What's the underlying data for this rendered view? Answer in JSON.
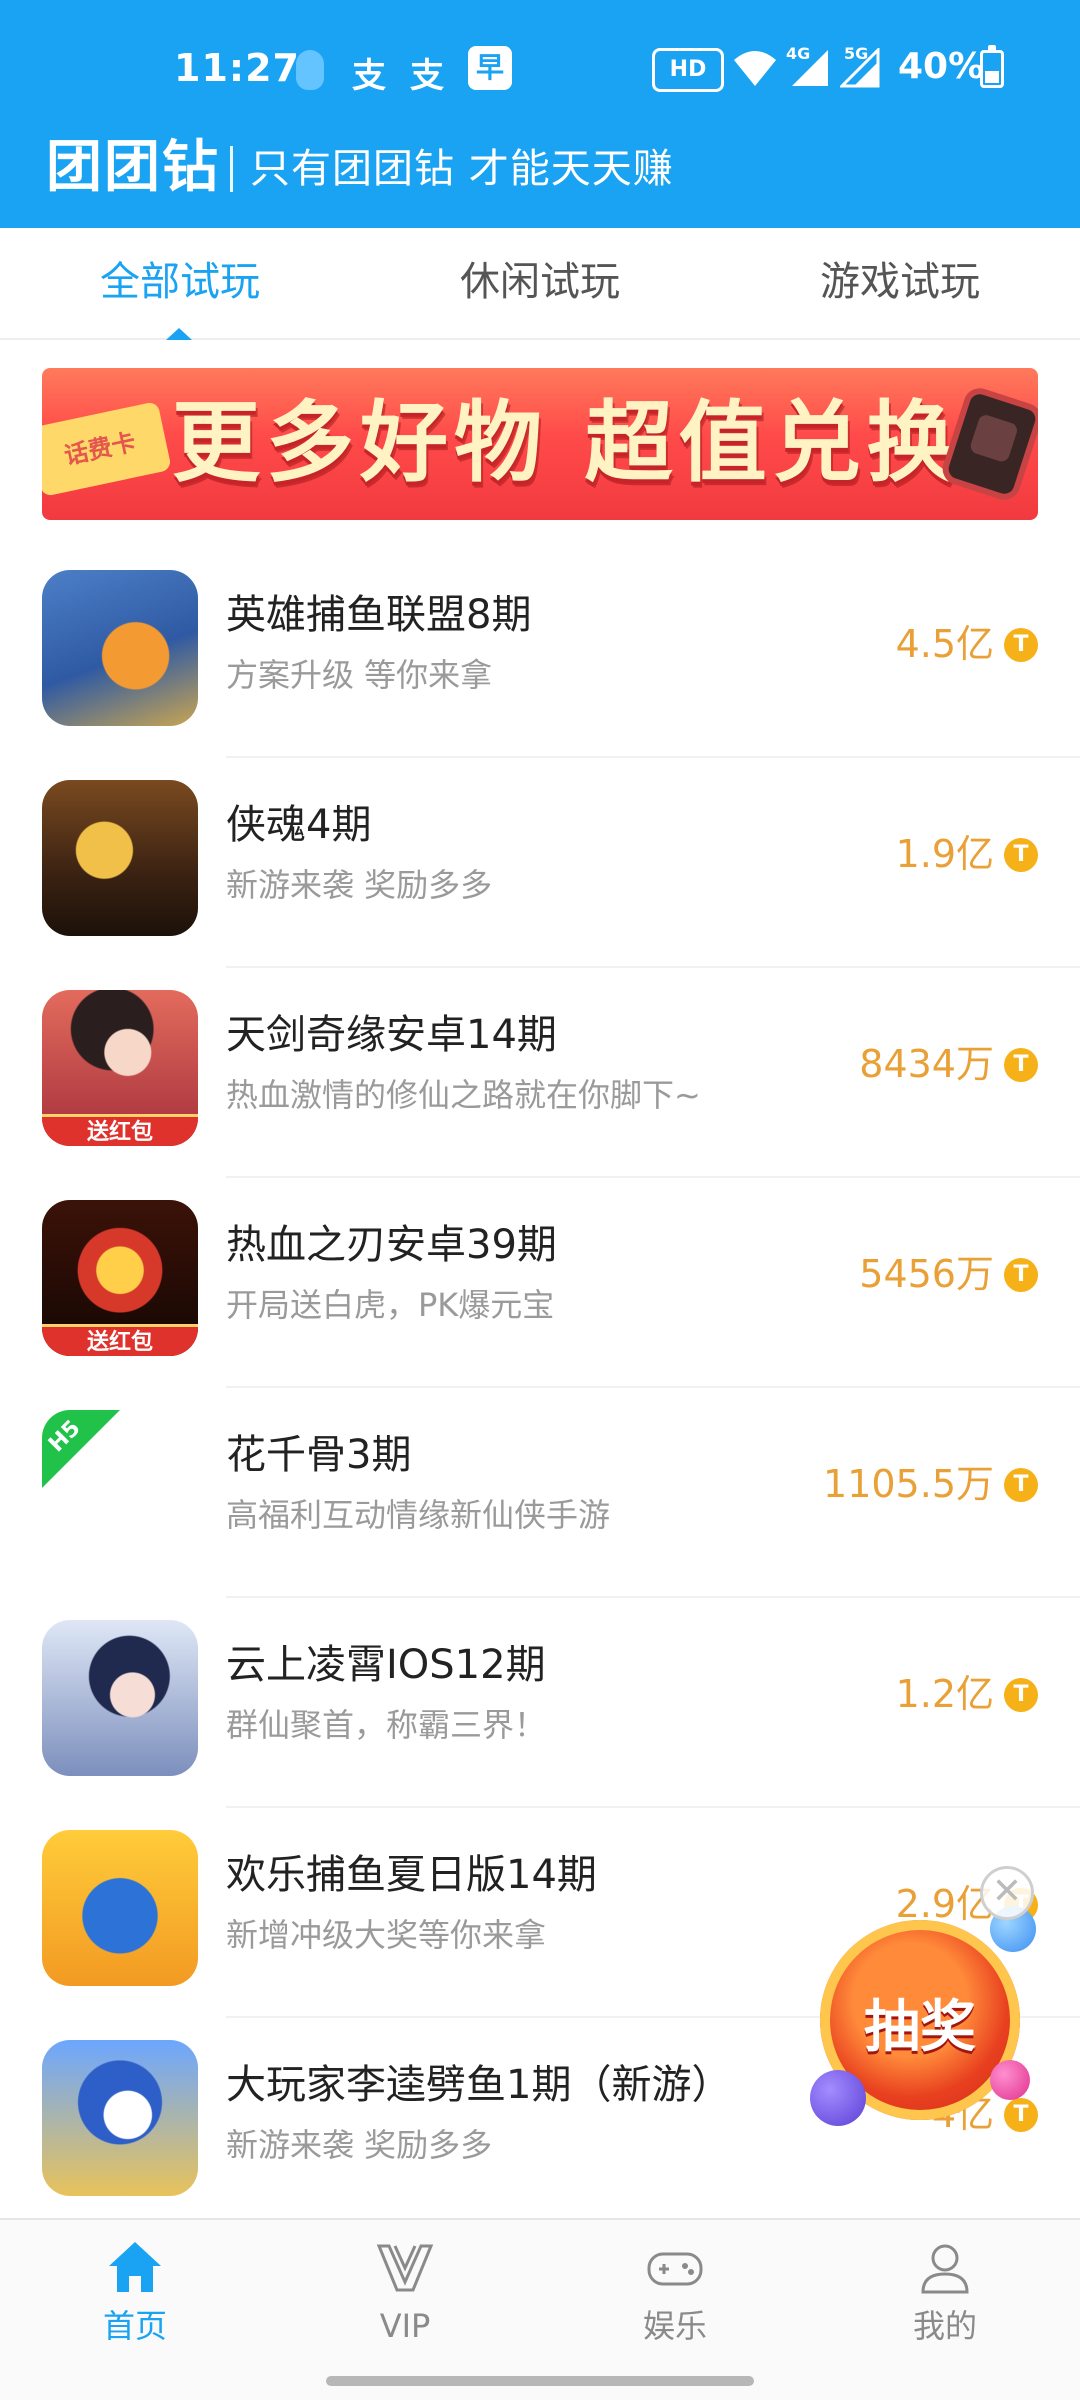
{
  "status_bar": {
    "time": "11:27",
    "app_glyphs": [
      "支",
      "支",
      "早"
    ],
    "hd_label": "HD",
    "net_labels": [
      "4G",
      "5G"
    ],
    "battery_percent": "40%"
  },
  "header": {
    "brand": "团团钻",
    "slogan": "只有团团钻 才能天天赚",
    "background_color": "#1aa3f2"
  },
  "tabs": [
    {
      "label": "全部试玩",
      "active": true
    },
    {
      "label": "休闲试玩",
      "active": false
    },
    {
      "label": "游戏试玩",
      "active": false
    }
  ],
  "banner": {
    "ticket_text": "话费卡",
    "title": "更多好物 超值兑换"
  },
  "games": [
    {
      "name": "英雄捕鱼联盟8期",
      "desc": "方案升级 等你来拿",
      "reward": "4.5亿",
      "icon": "fish-game-icon",
      "tag": ""
    },
    {
      "name": "侠魂4期",
      "desc": "新游来袭 奖励多多",
      "reward": "1.9亿",
      "icon": "xiahun-game-icon",
      "tag": ""
    },
    {
      "name": "天剑奇缘安卓14期",
      "desc": "热血激情的修仙之路就在你脚下~",
      "reward": "8434万",
      "icon": "tianjian-game-icon",
      "tag": "送红包"
    },
    {
      "name": "热血之刃安卓39期",
      "desc": "开局送白虎，PK爆元宝",
      "reward": "5456万",
      "icon": "rexue-game-icon",
      "tag": "送红包"
    },
    {
      "name": "花千骨3期",
      "desc": "高福利互动情缘新仙侠手游",
      "reward": "1105.5万",
      "icon": "h5-game-icon",
      "tag": "H5"
    },
    {
      "name": "云上凌霄IOS12期",
      "desc": "群仙聚首，称霸三界！",
      "reward": "1.2亿",
      "icon": "yunshang-game-icon",
      "tag": ""
    },
    {
      "name": "欢乐捕鱼夏日版14期",
      "desc": "新增冲级大奖等你来拿",
      "reward": "2.9亿",
      "icon": "huanle-fish-game-icon",
      "tag": ""
    },
    {
      "name": "大玩家李逵劈鱼1期（新游）",
      "desc": "新游来袭 奖励多多",
      "reward": "4亿",
      "icon": "dawanjia-game-icon",
      "tag": ""
    }
  ],
  "coin_symbol": "T",
  "reward_color": "#e9a036",
  "lottery": {
    "label": "抽奖",
    "close_symbol": "✕"
  },
  "bottom_nav": [
    {
      "label": "首页",
      "icon": "home-icon",
      "active": true
    },
    {
      "label": "VIP",
      "icon": "vip-icon",
      "active": false
    },
    {
      "label": "娱乐",
      "icon": "gamepad-icon",
      "active": false
    },
    {
      "label": "我的",
      "icon": "user-icon",
      "active": false
    }
  ]
}
